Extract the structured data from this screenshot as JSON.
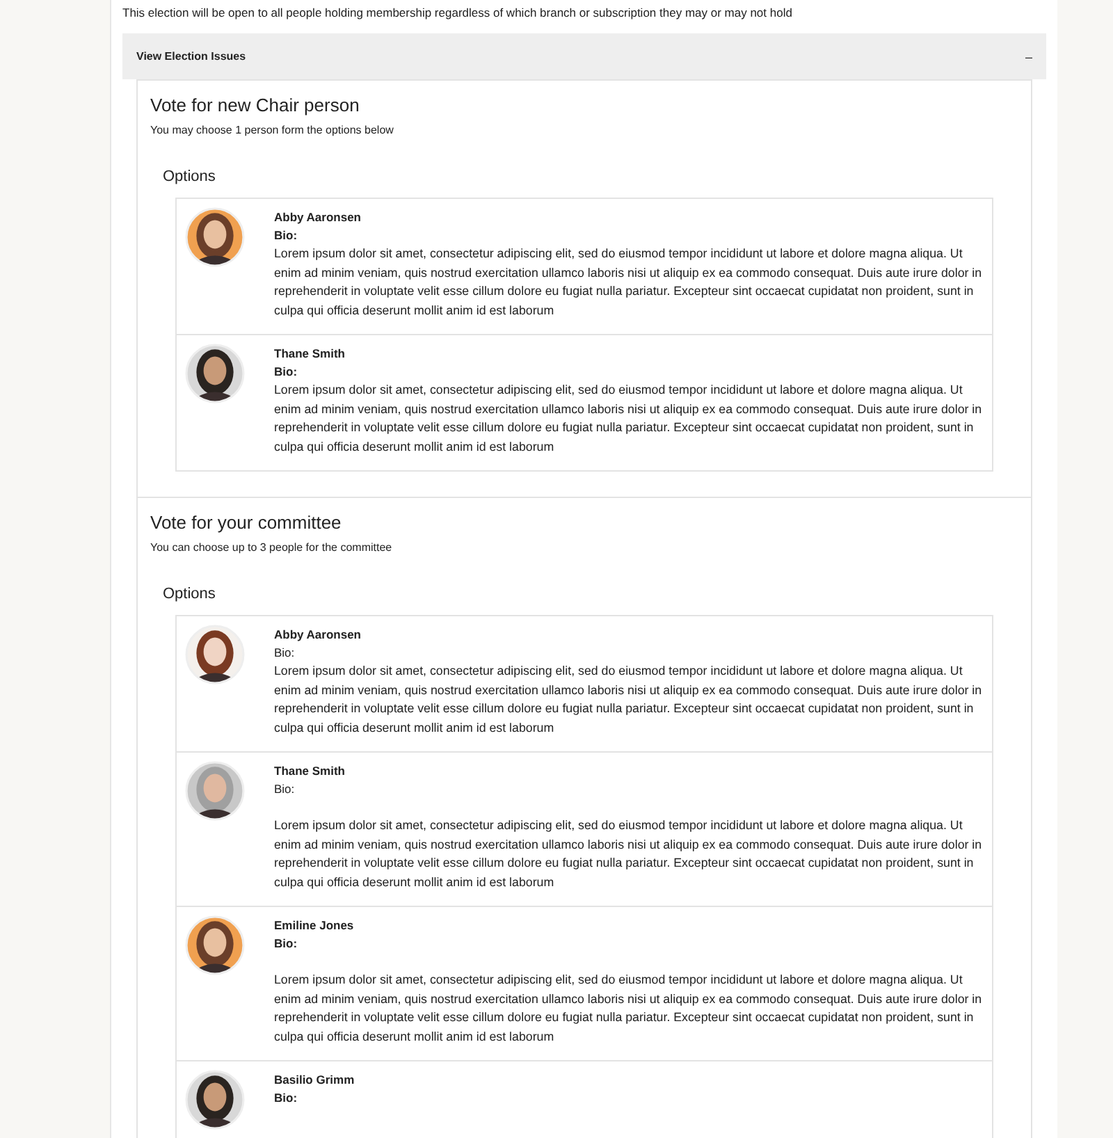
{
  "intro": "This election will be open to all people holding membership regardless of which branch or subscription they may or may not hold",
  "accordion": {
    "title": "View Election Issues",
    "toggle": "–",
    "expanded": true
  },
  "issues": [
    {
      "title": "Vote for new Chair person",
      "instruction": "You may choose 1 person form the options below",
      "options_heading": "Options",
      "candidates": [
        {
          "name": "Abby Aaronsen",
          "bio_label": "Bio:",
          "bio_label_bold": true,
          "spaced": false,
          "bio": "Lorem ipsum dolor sit amet, consectetur adipiscing elit, sed do eiusmod tempor incididunt ut labore et dolore magna aliqua. Ut enim ad minim veniam, quis nostrud exercitation ullamco laboris nisi ut aliquip ex ea commodo consequat. Duis aute irure dolor in reprehenderit in voluptate velit esse cillum dolore eu fugiat nulla pariatur. Excepteur sint occaecat cupidatat non proident, sunt in culpa qui officia deserunt mollit anim id est laborum"
        },
        {
          "name": "Thane Smith",
          "bio_label": "Bio:",
          "bio_label_bold": true,
          "spaced": false,
          "bio": "Lorem ipsum dolor sit amet, consectetur adipiscing elit, sed do eiusmod tempor incididunt ut labore et dolore magna aliqua. Ut enim ad minim veniam, quis nostrud exercitation ullamco laboris nisi ut aliquip ex ea commodo consequat. Duis aute irure dolor in reprehenderit in voluptate velit esse cillum dolore eu fugiat nulla pariatur. Excepteur sint occaecat cupidatat non proident, sunt in culpa qui officia deserunt mollit anim id est laborum"
        }
      ]
    },
    {
      "title": "Vote for your committee",
      "instruction": "You can choose up to 3 people for the committee",
      "options_heading": "Options",
      "candidates": [
        {
          "name": "Abby Aaronsen",
          "bio_label": "Bio:",
          "bio_label_bold": false,
          "spaced": false,
          "bio": "Lorem ipsum dolor sit amet, consectetur adipiscing elit, sed do eiusmod tempor incididunt ut labore et dolore magna aliqua. Ut enim ad minim veniam, quis nostrud exercitation ullamco laboris nisi ut aliquip ex ea commodo consequat. Duis aute irure dolor in reprehenderit in voluptate velit esse cillum dolore eu fugiat nulla pariatur. Excepteur sint occaecat cupidatat non proident, sunt in culpa qui officia deserunt mollit anim id est laborum"
        },
        {
          "name": "Thane Smith",
          "bio_label": "Bio:",
          "bio_label_bold": false,
          "spaced": true,
          "bio": "Lorem ipsum dolor sit amet, consectetur adipiscing elit, sed do eiusmod tempor incididunt ut labore et dolore magna aliqua. Ut enim ad minim veniam, quis nostrud exercitation ullamco laboris nisi ut aliquip ex ea commodo consequat. Duis aute irure dolor in reprehenderit in voluptate velit esse cillum dolore eu fugiat nulla pariatur. Excepteur sint occaecat cupidatat non proident, sunt in culpa qui officia deserunt mollit anim id est laborum"
        },
        {
          "name": "Emiline Jones",
          "bio_label": "Bio:",
          "bio_label_bold": true,
          "spaced": true,
          "bio": "Lorem ipsum dolor sit amet, consectetur adipiscing elit, sed do eiusmod tempor incididunt ut labore et dolore magna aliqua. Ut enim ad minim veniam, quis nostrud exercitation ullamco laboris nisi ut aliquip ex ea commodo consequat. Duis aute irure dolor in reprehenderit in voluptate velit esse cillum dolore eu fugiat nulla pariatur. Excepteur sint occaecat cupidatat non proident, sunt in culpa qui officia deserunt mollit anim id est laborum"
        },
        {
          "name": "Basilio Grimm",
          "bio_label": "Bio:",
          "bio_label_bold": true
        }
      ]
    }
  ]
}
